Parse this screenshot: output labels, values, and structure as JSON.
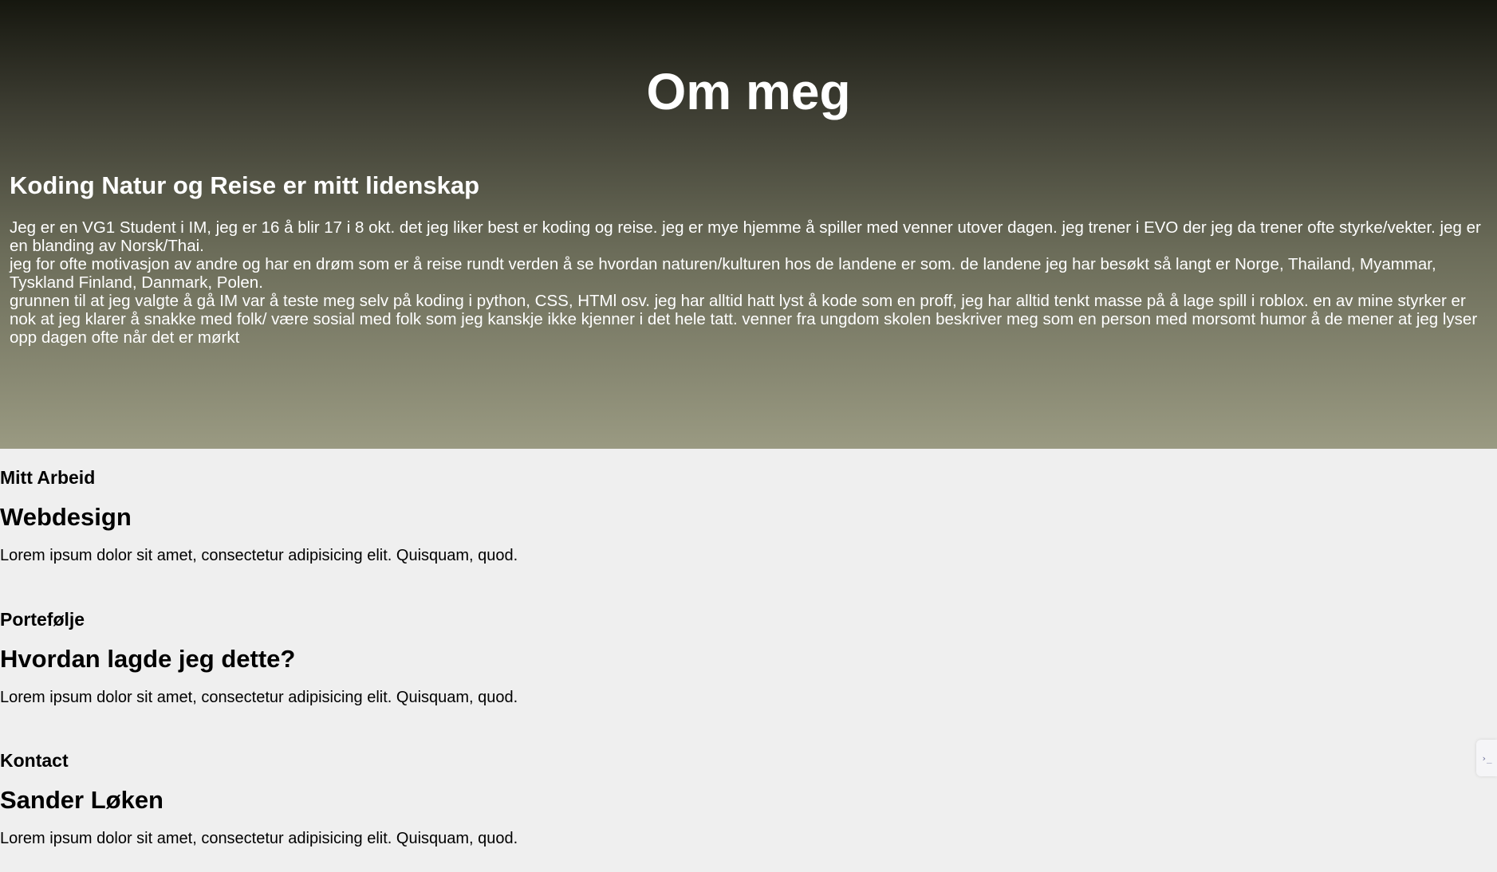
{
  "hero": {
    "title": "Om meg",
    "subtitle": "Koding Natur og Reise er mitt lidenskap",
    "paragraphs": [
      "Jeg er en VG1 Student i IM, jeg er 16 å blir 17 i 8 okt. det jeg liker best er koding og reise. jeg er mye hjemme å spiller med venner utover dagen. jeg trener i EVO der jeg da trener ofte styrke/vekter. jeg er en blanding av Norsk/Thai.",
      "jeg for ofte motivasjon av andre og har en drøm som er å reise rundt verden å se hvordan naturen/kulturen hos de landene er som. de landene jeg har besøkt så langt er Norge, Thailand, Myammar, Tyskland Finland, Danmark, Polen.",
      "grunnen til at jeg valgte å gå IM var å teste meg selv på koding i python, CSS, HTMl osv. jeg har alltid hatt lyst å kode som en proff, jeg har alltid tenkt masse på å lage spill i roblox. en av mine styrker er nok at jeg klarer å snakke med folk/ være sosial med folk som jeg kanskje ikke kjenner i det hele tatt. venner fra ungdom skolen beskriver meg som en person med morsomt humor å de mener at jeg lyser opp dagen ofte når det er mørkt"
    ]
  },
  "sections": [
    {
      "label": "Mitt Arbeid",
      "heading": "Webdesign",
      "text": "Lorem ipsum dolor sit amet, consectetur adipisicing elit. Quisquam, quod."
    },
    {
      "label": "Portefølje",
      "heading": "Hvordan lagde jeg dette?",
      "text": "Lorem ipsum dolor sit amet, consectetur adipisicing elit. Quisquam, quod."
    },
    {
      "label": "Kontact",
      "heading": "Sander Løken",
      "text": "Lorem ipsum dolor sit amet, consectetur adipisicing elit. Quisquam, quod."
    }
  ],
  "side_widget": {
    "icon": "terminal-icon",
    "glyph": "›_"
  },
  "colors": {
    "hero_gradient_top": "#16170f",
    "hero_gradient_bottom": "#9a9a82",
    "page_background": "#efefef",
    "hero_text": "#ffffff"
  }
}
